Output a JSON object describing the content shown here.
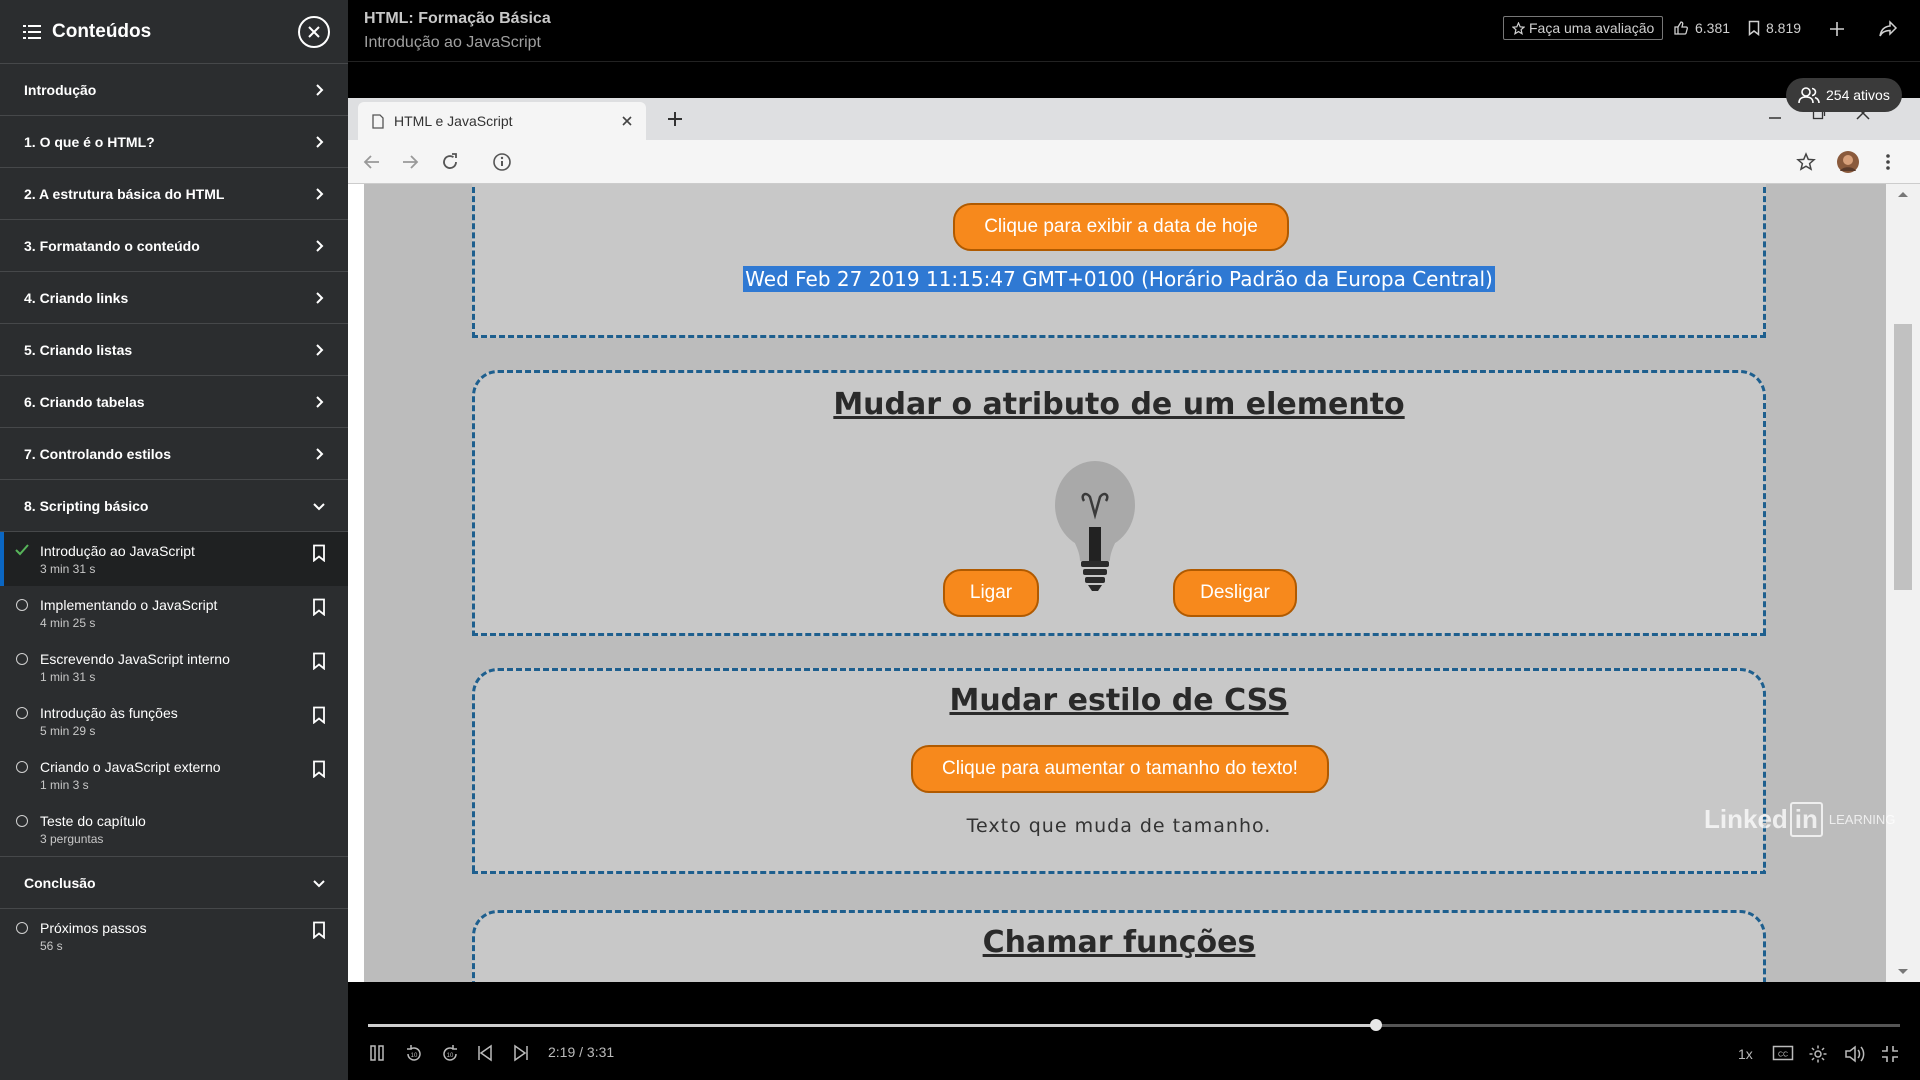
{
  "sidebar": {
    "title": "Conteúdos",
    "chapters_before": [
      {
        "label": "Introdução"
      },
      {
        "label": "1. O que é o HTML?"
      },
      {
        "label": "2. A estrutura básica do HTML"
      },
      {
        "label": "3. Formatando o conteúdo"
      },
      {
        "label": "4. Criando links"
      },
      {
        "label": "5. Criando listas"
      },
      {
        "label": "6. Criando tabelas"
      },
      {
        "label": "7. Controlando estilos"
      }
    ],
    "open_chapter": {
      "label": "8. Scripting básico"
    },
    "lessons": [
      {
        "title": "Introdução ao JavaScript",
        "duration": "3 min 31 s",
        "completed": true,
        "active": true,
        "bookmark": true
      },
      {
        "title": "Implementando o JavaScript",
        "duration": "4 min 25 s",
        "completed": false,
        "active": false,
        "bookmark": true
      },
      {
        "title": "Escrevendo JavaScript interno",
        "duration": "1 min 31 s",
        "completed": false,
        "active": false,
        "bookmark": true
      },
      {
        "title": "Introdução às funções",
        "duration": "5 min 29 s",
        "completed": false,
        "active": false,
        "bookmark": true
      },
      {
        "title": "Criando o JavaScript externo",
        "duration": "1 min 3 s",
        "completed": false,
        "active": false,
        "bookmark": true
      },
      {
        "title": "Teste do capítulo",
        "duration": "3 perguntas",
        "completed": false,
        "active": false,
        "bookmark": false
      }
    ],
    "last_chapter": {
      "label": "Conclusão"
    },
    "last_lessons": [
      {
        "title": "Próximos passos",
        "duration": "56 s",
        "completed": false,
        "active": false,
        "bookmark": true
      }
    ]
  },
  "header": {
    "course_title": "HTML: Formação Básica",
    "lesson_title": "Introdução ao JavaScript",
    "rate_label": "Faça uma avaliação",
    "likes": "6.381",
    "saves": "8.819"
  },
  "video": {
    "active_users": "254 ativos",
    "browser_tab": "HTML e JavaScript",
    "page": {
      "date_button": "Clique para exibir a data de hoje",
      "date_output": "Wed Feb 27 2019 11:15:47 GMT+0100 (Horário Padrão da Europa Central)",
      "attr_heading": "Mudar o atributo de um elemento",
      "on_button": "Ligar",
      "off_button": "Desligar",
      "css_heading": "Mudar estilo de CSS",
      "size_button": "Clique para aumentar o tamanho do texto!",
      "size_text": "Texto que muda de tamanho.",
      "functions_heading": "Chamar funções"
    },
    "watermark": {
      "linked": "Linked",
      "in": "in",
      "learning": "LEARNING"
    }
  },
  "player": {
    "time": "2:19 / 3:31",
    "progress": 0.658,
    "speed": "1x"
  },
  "colors": {
    "accent": "#0a66c2",
    "button_orange": "#f7891c",
    "sidebar_bg": "#2b2d2f",
    "selection": "#2f79d3"
  }
}
